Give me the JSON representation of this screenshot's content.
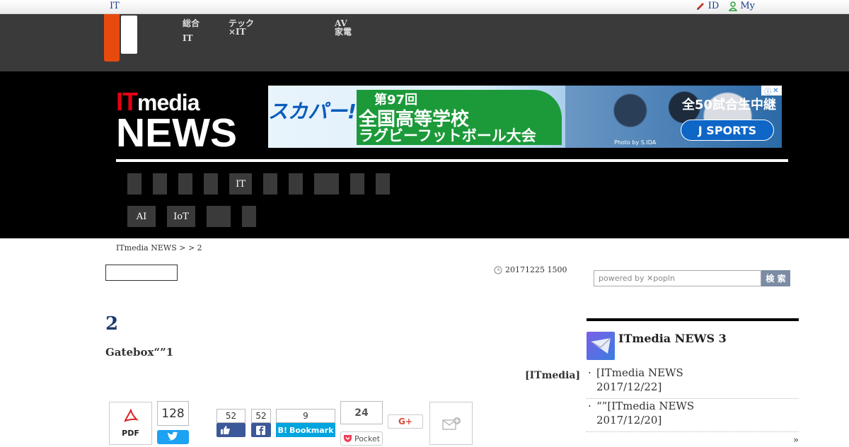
{
  "topbar": {
    "left_label": "IT",
    "id_label": "ID",
    "my_label": "My"
  },
  "darknav": {
    "items": [
      {
        "line1": "総合",
        "line2": "IT"
      },
      {
        "line1": "テック",
        "line2": "×IT"
      },
      {
        "line1": "AV",
        "line2": "家電"
      }
    ]
  },
  "brand": {
    "it": "IT",
    "media": "media",
    "news": "NEWS"
  },
  "ad": {
    "left_text": "スカパー!",
    "line1": "第97回",
    "line2": "全国高等学校",
    "line3": "ラグビーフットボール大会",
    "right_text": "全50試合生中継",
    "cta": "J SPORTS",
    "credit": "Photo by S.IDA",
    "info_icon": "ⓘ",
    "close_icon": "✕"
  },
  "nav": {
    "row1": [
      "",
      "",
      "",
      "",
      "IT",
      "",
      "",
      "",
      "",
      ""
    ],
    "row2": [
      "AI",
      "IoT",
      "",
      ""
    ]
  },
  "breadcrumb": "ITmedia NEWS >  > 2",
  "article": {
    "date": "20171225 1500",
    "title": "2",
    "subtitle": "Gatebox“”1",
    "source": "[ITmedia]"
  },
  "search": {
    "placeholder": "powered by ✕popln",
    "button": "検 索"
  },
  "share": {
    "pdf_label": "PDF",
    "tweet_count": "128",
    "like_count": "52",
    "fb_share_count": "52",
    "hatena_count": "9",
    "hatena_label": "Bookmark",
    "pocket_count": "24",
    "pocket_label": "Pocket",
    "gplus_label": "G+"
  },
  "sidebar": {
    "title": "ITmedia NEWS 3",
    "items": [
      {
        "line1": "[ITmedia NEWS",
        "line2": "2017/12/22]"
      },
      {
        "line1": "“”[ITmedia NEWS",
        "line2": "2017/12/20]"
      }
    ],
    "more": "»"
  },
  "colors": {
    "accent_orange": "#e84a0e",
    "brand_red": "#e60012",
    "title_blue": "#1c3a6e",
    "twitter": "#1da1f2",
    "facebook": "#3b5998",
    "hatena": "#00a4de"
  }
}
